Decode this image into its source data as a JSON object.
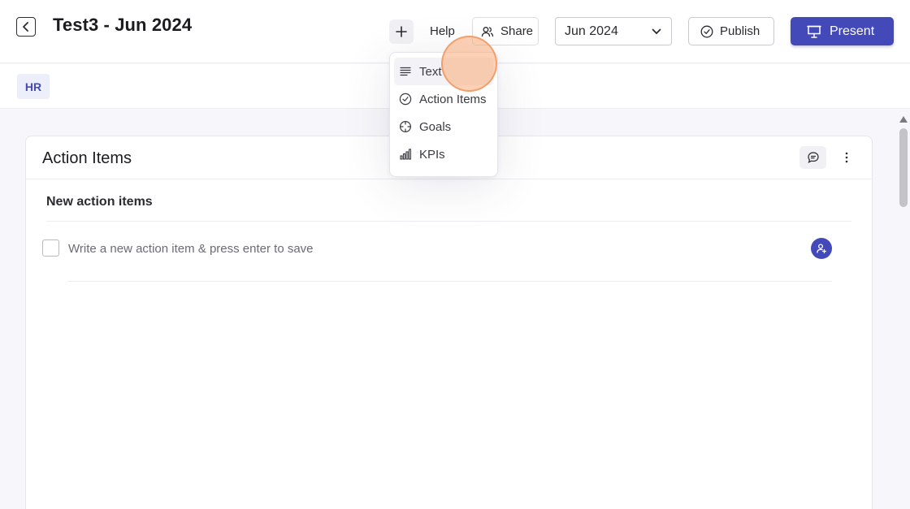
{
  "header": {
    "title": "Test3 - Jun 2024",
    "help_label": "Help",
    "share_label": "Share",
    "month_value": "Jun 2024",
    "publish_label": "Publish",
    "present_label": "Present"
  },
  "tags": {
    "hr_label": "HR"
  },
  "add_menu": {
    "items": [
      {
        "label": "Text",
        "icon": "text-lines-icon"
      },
      {
        "label": "Action Items",
        "icon": "check-circle-icon"
      },
      {
        "label": "Goals",
        "icon": "crosshair-icon"
      },
      {
        "label": "KPIs",
        "icon": "bar-chart-icon"
      }
    ]
  },
  "card": {
    "title": "Action Items",
    "section_title": "New action items",
    "new_item_placeholder": "Write a new action item & press enter to save"
  },
  "colors": {
    "accent": "#4349b8",
    "click_marker": "#f7aa76"
  }
}
